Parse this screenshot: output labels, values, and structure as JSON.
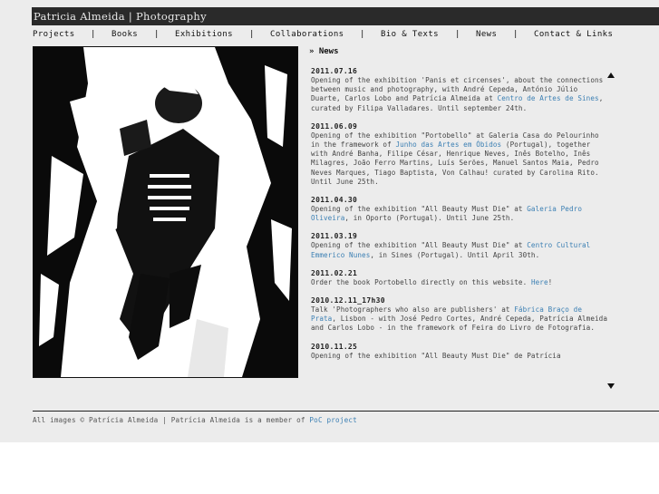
{
  "header": {
    "title": "Patricia Almeida | Photography"
  },
  "nav": {
    "items": [
      {
        "label": "Projects"
      },
      {
        "label": "Books"
      },
      {
        "label": "Exhibitions"
      },
      {
        "label": "Collaborations"
      },
      {
        "label": "Bio & Texts"
      },
      {
        "label": "News"
      },
      {
        "label": "Contact & Links"
      }
    ],
    "separator": "|"
  },
  "news": {
    "heading": "» News",
    "items": [
      {
        "date": "2011.07.16",
        "text_before": "Opening of the exhibition 'Panis et circenses', about the connections between music and photography, with André Cepeda, António Júlio Duarte, Carlos Lobo and Patrícia Almeida at ",
        "link": "Centro de Artes de Sines",
        "text_after": ", curated by Filipa Valladares. Until september 24th."
      },
      {
        "date": "2011.06.09",
        "text_before": "Opening of the exhibition \"Portobello\" at Galeria Casa do Pelourinho in the framework of ",
        "link": "Junho das Artes em Óbidos",
        "text_after": " (Portugal), together with André Banha, Filipe César, Henrique Neves, Inês Botelho, Inês Milagres, João Ferro Martins, Luís Serões, Manuel Santos Maia, Pedro Neves Marques, Tiago Baptista, Von Calhau! curated by Carolina Rito. Until June 25th."
      },
      {
        "date": "2011.04.30",
        "text_before": "Opening of the exhibition \"All Beauty Must Die\" at ",
        "link": "Galeria Pedro Oliveira",
        "text_after": ", in Oporto (Portugal). Until June 25th."
      },
      {
        "date": "2011.03.19",
        "text_before": "Opening of the exhibition \"All Beauty Must Die\" at ",
        "link": "Centro Cultural Emmerico Nunes",
        "text_after": ", in Sines (Portugal). Until April 30th."
      },
      {
        "date": "2011.02.21",
        "text_before": "Order the book Portobello directly on this website. ",
        "link": "Here",
        "text_after": "!"
      },
      {
        "date": "2010.12.11_17h30",
        "text_before": "Talk 'Photographers who also are publishers' at ",
        "link": "Fábrica Braço de Prata",
        "text_after": ", Lisbon - with José Pedro Cortes, André Cepeda, Patrícia Almeida and Carlos Lobo - in the framework of Feira do Livro de Fotografia."
      },
      {
        "date": "2010.11.25",
        "text_before": "Opening of the exhibition \"All Beauty Must Die\" de Patrícia",
        "link": "",
        "text_after": ""
      }
    ]
  },
  "footer": {
    "text_before": "All images © Patrícia Almeida | Patrícia Almeida is a member of ",
    "link": "PoC project"
  },
  "colors": {
    "title_bar": "#2a2a2a",
    "link": "#3b7fb3",
    "page_bg": "#ececec"
  }
}
